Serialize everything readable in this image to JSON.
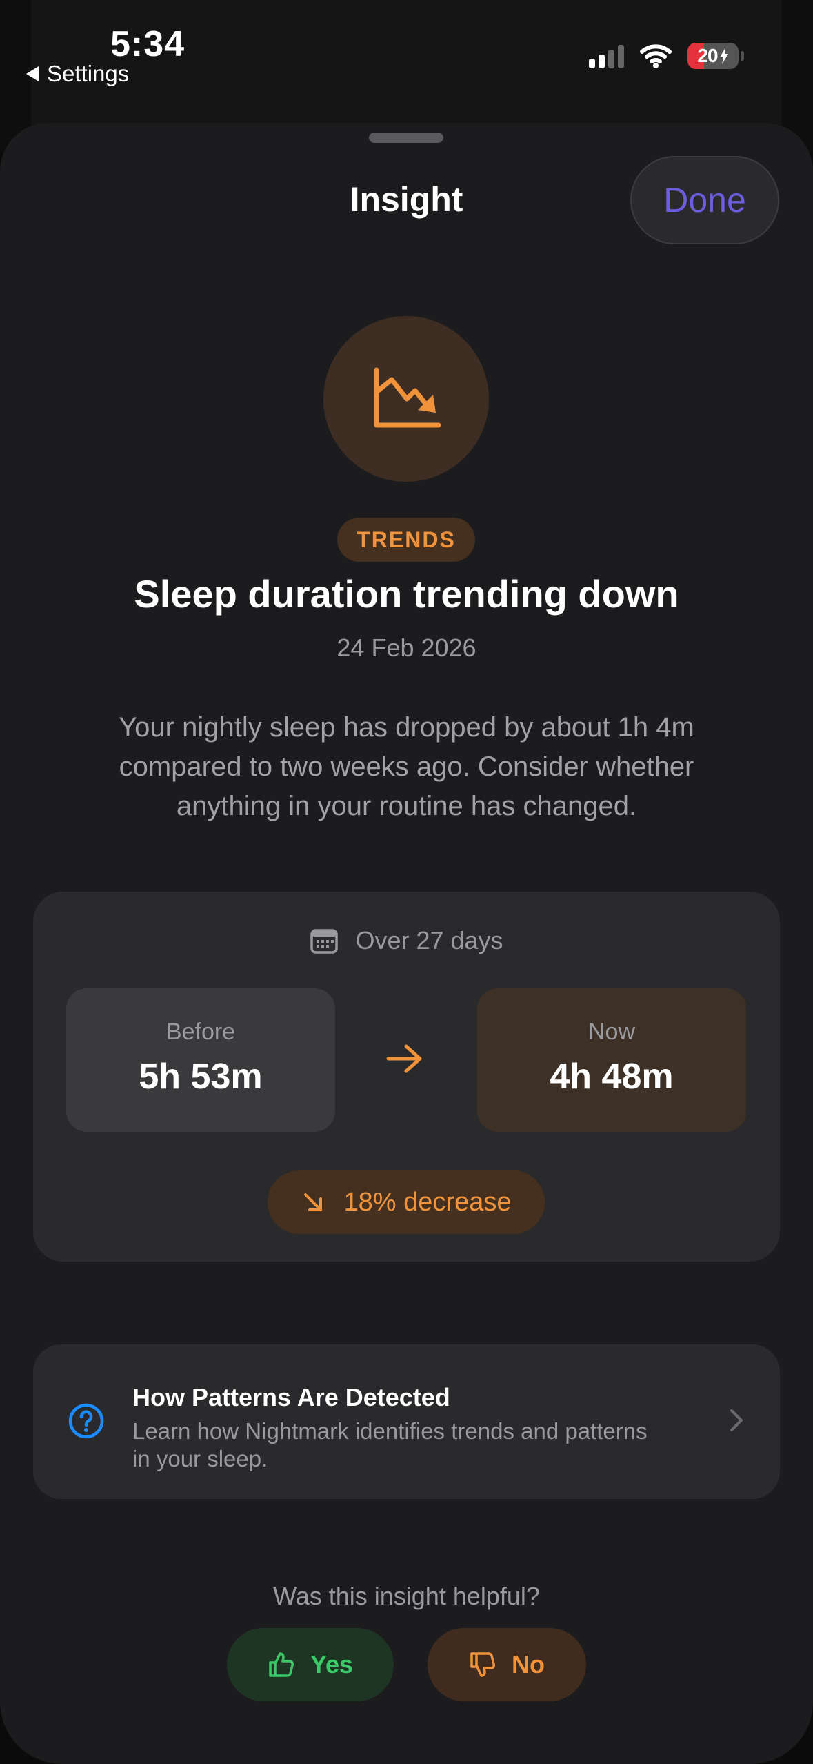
{
  "status_bar": {
    "time": "5:34",
    "back_label": "Settings",
    "battery_level": "20"
  },
  "sheet": {
    "title": "Insight",
    "done_label": "Done"
  },
  "insight": {
    "category": "TRENDS",
    "headline": "Sleep duration trending down",
    "date": "24 Feb 2026",
    "description": "Your nightly sleep has dropped by about 1h 4m compared to two weeks ago. Consider whether anything in your routine has changed."
  },
  "comparison": {
    "period": "Over 27 days",
    "before_label": "Before",
    "before_value": "5h 53m",
    "now_label": "Now",
    "now_value": "4h 48m",
    "change": "18% decrease"
  },
  "info_row": {
    "title": "How Patterns Are Detected",
    "body": "Learn how Nightmark identifies trends and patterns in your sleep."
  },
  "feedback": {
    "question": "Was this insight helpful?",
    "yes_label": "Yes",
    "no_label": "No"
  },
  "colors": {
    "accent_orange": "#f0933a",
    "done_purple": "#6d5ee0",
    "yes_green": "#3dc96a",
    "info_blue": "#1a8cff"
  }
}
